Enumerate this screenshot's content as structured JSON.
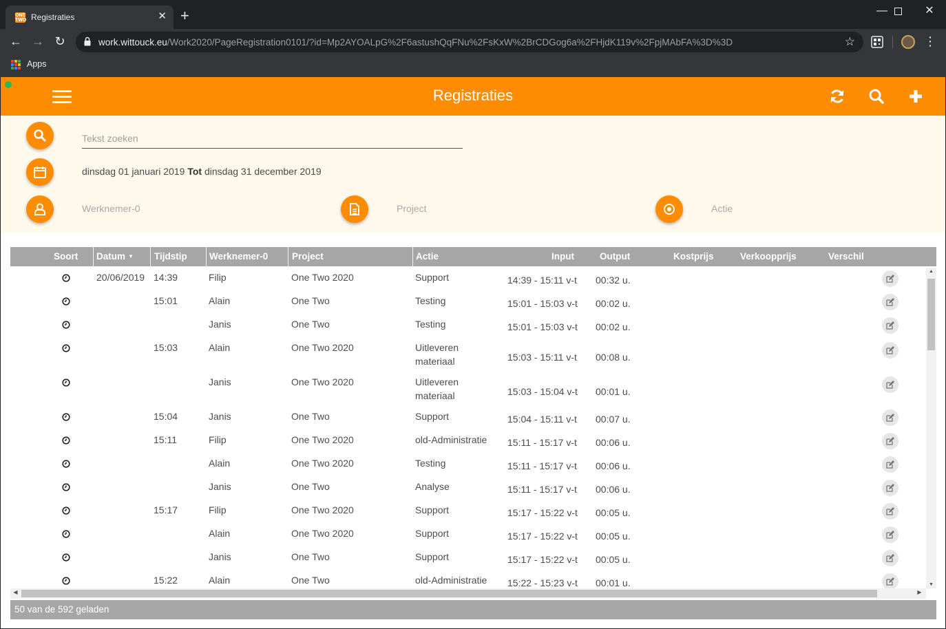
{
  "browser": {
    "tab_title": "Registraties",
    "favicon_text": "ONE TWO",
    "url_host": "work.wittouck.eu",
    "url_path": "/Work2020/PageRegistration0101/?id=Mp2AYOALpG%2F6astushQqFNu%2FsKxW%2BrCDGog6a%2FHjdK119v%2FpjMAbFA%3D%3D",
    "bookmark_apps": "Apps"
  },
  "app": {
    "title": "Registraties",
    "accent_color": "#fe8c00"
  },
  "filters": {
    "search_placeholder": "Tekst zoeken",
    "date_from": "dinsdag 01 januari 2019",
    "date_sep": "Tot",
    "date_to": "dinsdag 31 december 2019",
    "werknemer": "Werknemer-0",
    "project": "Project",
    "actie": "Actie"
  },
  "grid": {
    "columns": {
      "soort": "Soort",
      "datum": "Datum",
      "tijdstip": "Tijdstip",
      "werknemer": "Werknemer-0",
      "project": "Project",
      "actie": "Actie",
      "input": "Input",
      "output": "Output",
      "kostprijs": "Kostprijs",
      "verkoopprijs": "Verkoopprijs",
      "verschil": "Verschil"
    },
    "sort_column": "Datum",
    "rows": [
      {
        "datum": "20/06/2019",
        "tijdstip": "14:39",
        "werknemer": "Filip",
        "project": "One Two 2020",
        "actie": [
          "Support"
        ],
        "input": "14:39 - 15:11 v-t",
        "output": "00:32 u."
      },
      {
        "datum": "",
        "tijdstip": "15:01",
        "werknemer": "Alain",
        "project": "One Two",
        "actie": [
          "Testing"
        ],
        "input": "15:01 - 15:03 v-t",
        "output": "00:02 u."
      },
      {
        "datum": "",
        "tijdstip": "",
        "werknemer": "Janis",
        "project": "One Two",
        "actie": [
          "Testing"
        ],
        "input": "15:01 - 15:03 v-t",
        "output": "00:02 u."
      },
      {
        "datum": "",
        "tijdstip": "15:03",
        "werknemer": "Alain",
        "project": "One Two 2020",
        "actie": [
          "Uitleveren",
          "materiaal"
        ],
        "input": "15:03 - 15:11 v-t",
        "output": "00:08 u."
      },
      {
        "datum": "",
        "tijdstip": "",
        "werknemer": "Janis",
        "project": "One Two 2020",
        "actie": [
          "Uitleveren",
          "materiaal"
        ],
        "input": "15:03 - 15:04 v-t",
        "output": "00:01 u."
      },
      {
        "datum": "",
        "tijdstip": "15:04",
        "werknemer": "Janis",
        "project": "One Two",
        "actie": [
          "Support"
        ],
        "input": "15:04 - 15:11 v-t",
        "output": "00:07 u."
      },
      {
        "datum": "",
        "tijdstip": "15:11",
        "werknemer": "Filip",
        "project": "One Two 2020",
        "actie": [
          "old-Administratie"
        ],
        "input": "15:11 - 15:17 v-t",
        "output": "00:06 u."
      },
      {
        "datum": "",
        "tijdstip": "",
        "werknemer": "Alain",
        "project": "One Two 2020",
        "actie": [
          "Testing"
        ],
        "input": "15:11 - 15:17 v-t",
        "output": "00:06 u."
      },
      {
        "datum": "",
        "tijdstip": "",
        "werknemer": "Janis",
        "project": "One Two",
        "actie": [
          "Analyse"
        ],
        "input": "15:11 - 15:17 v-t",
        "output": "00:06 u."
      },
      {
        "datum": "",
        "tijdstip": "15:17",
        "werknemer": "Filip",
        "project": "One Two 2020",
        "actie": [
          "Support"
        ],
        "input": "15:17 - 15:22 v-t",
        "output": "00:05 u."
      },
      {
        "datum": "",
        "tijdstip": "",
        "werknemer": "Alain",
        "project": "One Two 2020",
        "actie": [
          "Support"
        ],
        "input": "15:17 - 15:22 v-t",
        "output": "00:05 u."
      },
      {
        "datum": "",
        "tijdstip": "",
        "werknemer": "Janis",
        "project": "One Two",
        "actie": [
          "Support"
        ],
        "input": "15:17 - 15:22 v-t",
        "output": "00:05 u."
      },
      {
        "datum": "",
        "tijdstip": "15:22",
        "werknemer": "Alain",
        "project": "One Two",
        "actie": [
          "old-Administratie"
        ],
        "input": "15:22 - 15:23 v-t",
        "output": "00:01 u."
      }
    ],
    "footer": "50 van de 592 geladen"
  }
}
